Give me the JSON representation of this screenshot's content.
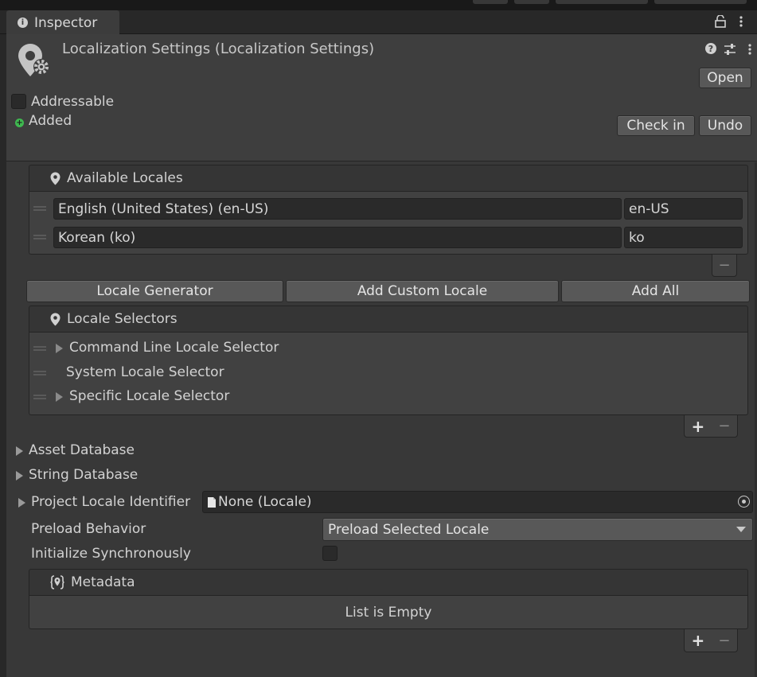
{
  "tab": {
    "label": "Inspector"
  },
  "header": {
    "title": "Localization Settings (Localization Settings)",
    "open_label": "Open",
    "addressable_label": "Addressable",
    "addressable_checked": false,
    "added_label": "Added",
    "check_in_label": "Check in",
    "undo_label": "Undo"
  },
  "available_locales": {
    "title": "Available Locales",
    "items": [
      {
        "name": "English (United States) (en-US)",
        "code": "en-US"
      },
      {
        "name": "Korean (ko)",
        "code": "ko"
      }
    ],
    "remove_label": "−"
  },
  "locale_buttons": {
    "generator": "Locale Generator",
    "custom": "Add Custom Locale",
    "add_all": "Add All"
  },
  "locale_selectors": {
    "title": "Locale Selectors",
    "items": [
      {
        "label": "Command Line Locale Selector",
        "expandable": true
      },
      {
        "label": "System Locale Selector",
        "expandable": false
      },
      {
        "label": "Specific Locale Selector",
        "expandable": true
      }
    ],
    "add_label": "+",
    "remove_label": "−"
  },
  "asset_database": "Asset Database",
  "string_database": "String Database",
  "project_locale": {
    "label": "Project Locale Identifier",
    "value": "None (Locale)"
  },
  "preload": {
    "label": "Preload Behavior",
    "value": "Preload Selected Locale"
  },
  "init_sync": {
    "label": "Initialize Synchronously",
    "checked": false
  },
  "metadata": {
    "title": "Metadata",
    "empty_text": "List is Empty",
    "add_label": "+",
    "remove_label": "−"
  },
  "colors": {
    "accent_added": "#3fb950",
    "background": "#383838"
  }
}
